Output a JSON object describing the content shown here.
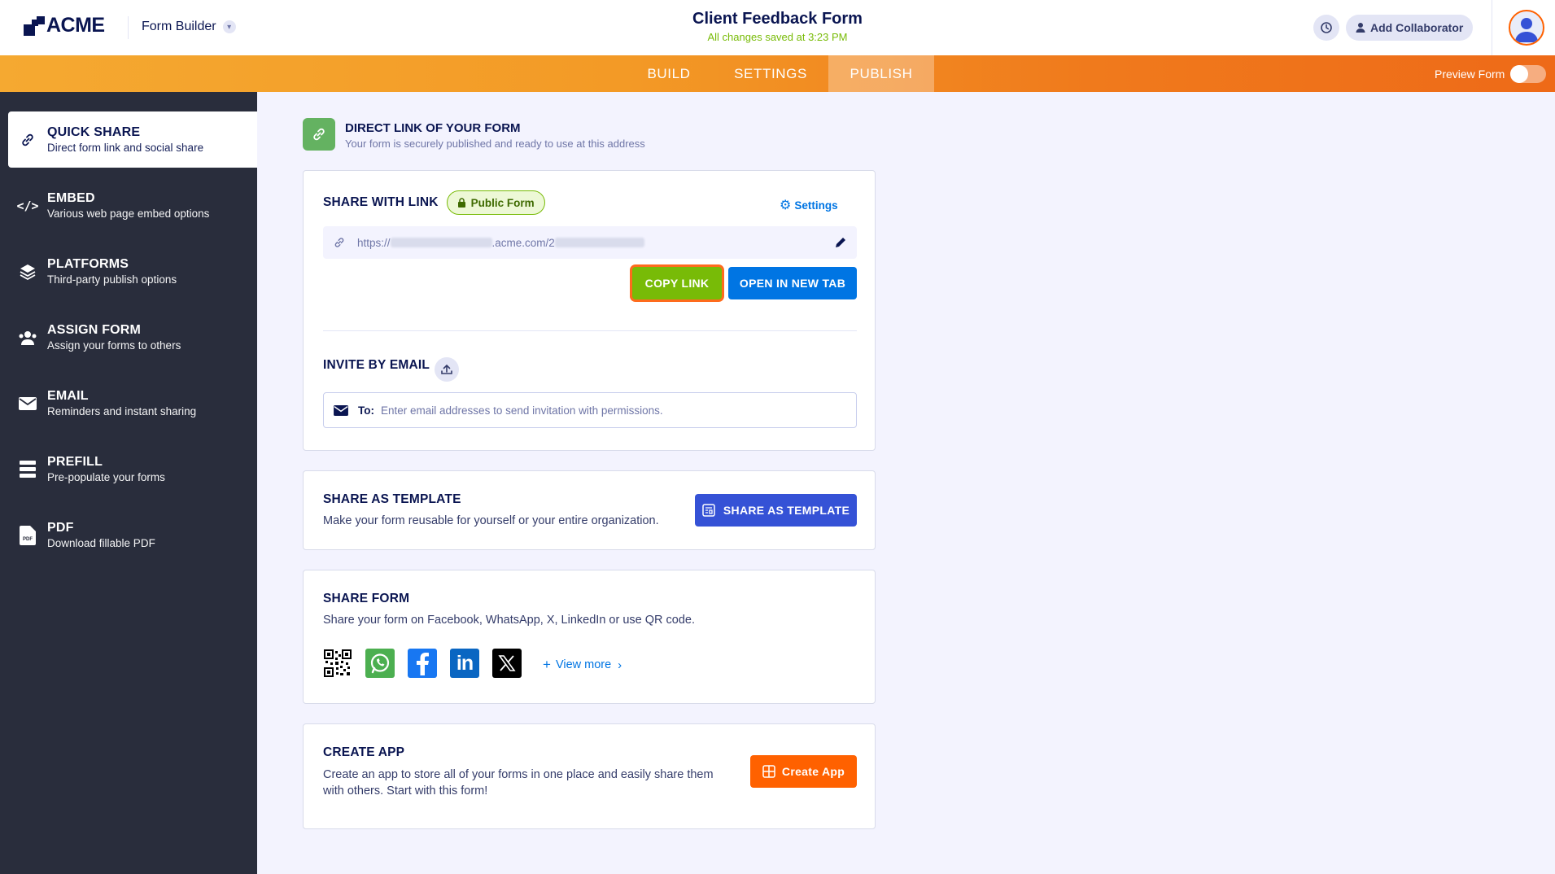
{
  "brand": {
    "logo_text": "ACME",
    "app_switcher": "Form Builder"
  },
  "header": {
    "form_title": "Client Feedback Form",
    "save_status": "All changes saved at 3:23 PM",
    "add_collaborator": "Add Collaborator"
  },
  "tabs": [
    {
      "label": "BUILD",
      "active": false
    },
    {
      "label": "SETTINGS",
      "active": false
    },
    {
      "label": "PUBLISH",
      "active": true
    }
  ],
  "preview": {
    "label": "Preview Form",
    "enabled": false
  },
  "sidebar": {
    "items": [
      {
        "title": "QUICK SHARE",
        "subtitle": "Direct form link and social share",
        "icon": "link-icon",
        "active": true
      },
      {
        "title": "EMBED",
        "subtitle": "Various web page embed options",
        "icon": "code-icon",
        "active": false
      },
      {
        "title": "PLATFORMS",
        "subtitle": "Third-party publish options",
        "icon": "layers-icon",
        "active": false
      },
      {
        "title": "ASSIGN FORM",
        "subtitle": "Assign your forms to others",
        "icon": "users-icon",
        "active": false
      },
      {
        "title": "EMAIL",
        "subtitle": "Reminders and instant sharing",
        "icon": "mail-icon",
        "active": false
      },
      {
        "title": "PREFILL",
        "subtitle": "Pre-populate your forms",
        "icon": "prefill-icon",
        "active": false
      },
      {
        "title": "PDF",
        "subtitle": "Download fillable PDF",
        "icon": "pdf-icon",
        "active": false
      }
    ]
  },
  "direct_link": {
    "title": "DIRECT LINK OF YOUR FORM",
    "subtitle": "Your form is securely published and ready to use at this address"
  },
  "share_link": {
    "title": "SHARE WITH LINK",
    "badge": "Public Form",
    "settings_label": "Settings",
    "url_prefix": "https://",
    "url_middle": ".acme.com/2",
    "copy_button": "COPY LINK",
    "open_button": "OPEN IN NEW TAB"
  },
  "invite": {
    "title": "INVITE BY EMAIL",
    "to_label": "To:",
    "placeholder": "Enter email addresses to send invitation with permissions."
  },
  "template": {
    "title": "SHARE AS TEMPLATE",
    "description": "Make your form reusable for yourself or your entire organization.",
    "button": "SHARE AS TEMPLATE"
  },
  "share_form": {
    "title": "SHARE FORM",
    "description": "Share your form on Facebook, WhatsApp, X, LinkedIn or use QR code.",
    "platforms": [
      "qr-code-icon",
      "whatsapp-icon",
      "facebook-icon",
      "linkedin-icon",
      "x-icon"
    ],
    "view_more": "View more"
  },
  "create_app": {
    "title": "CREATE APP",
    "description_line1": "Create an app to store all of your forms in one place and easily share them",
    "description_line2": "with others. Start with this form!",
    "button": "Create App"
  },
  "colors": {
    "navy": "#0a1551",
    "sidebar_bg": "#292d3c",
    "accent_orange": "#ff6100",
    "green": "#78bb07",
    "blue": "#0075e3",
    "indigo": "#3552d6"
  }
}
